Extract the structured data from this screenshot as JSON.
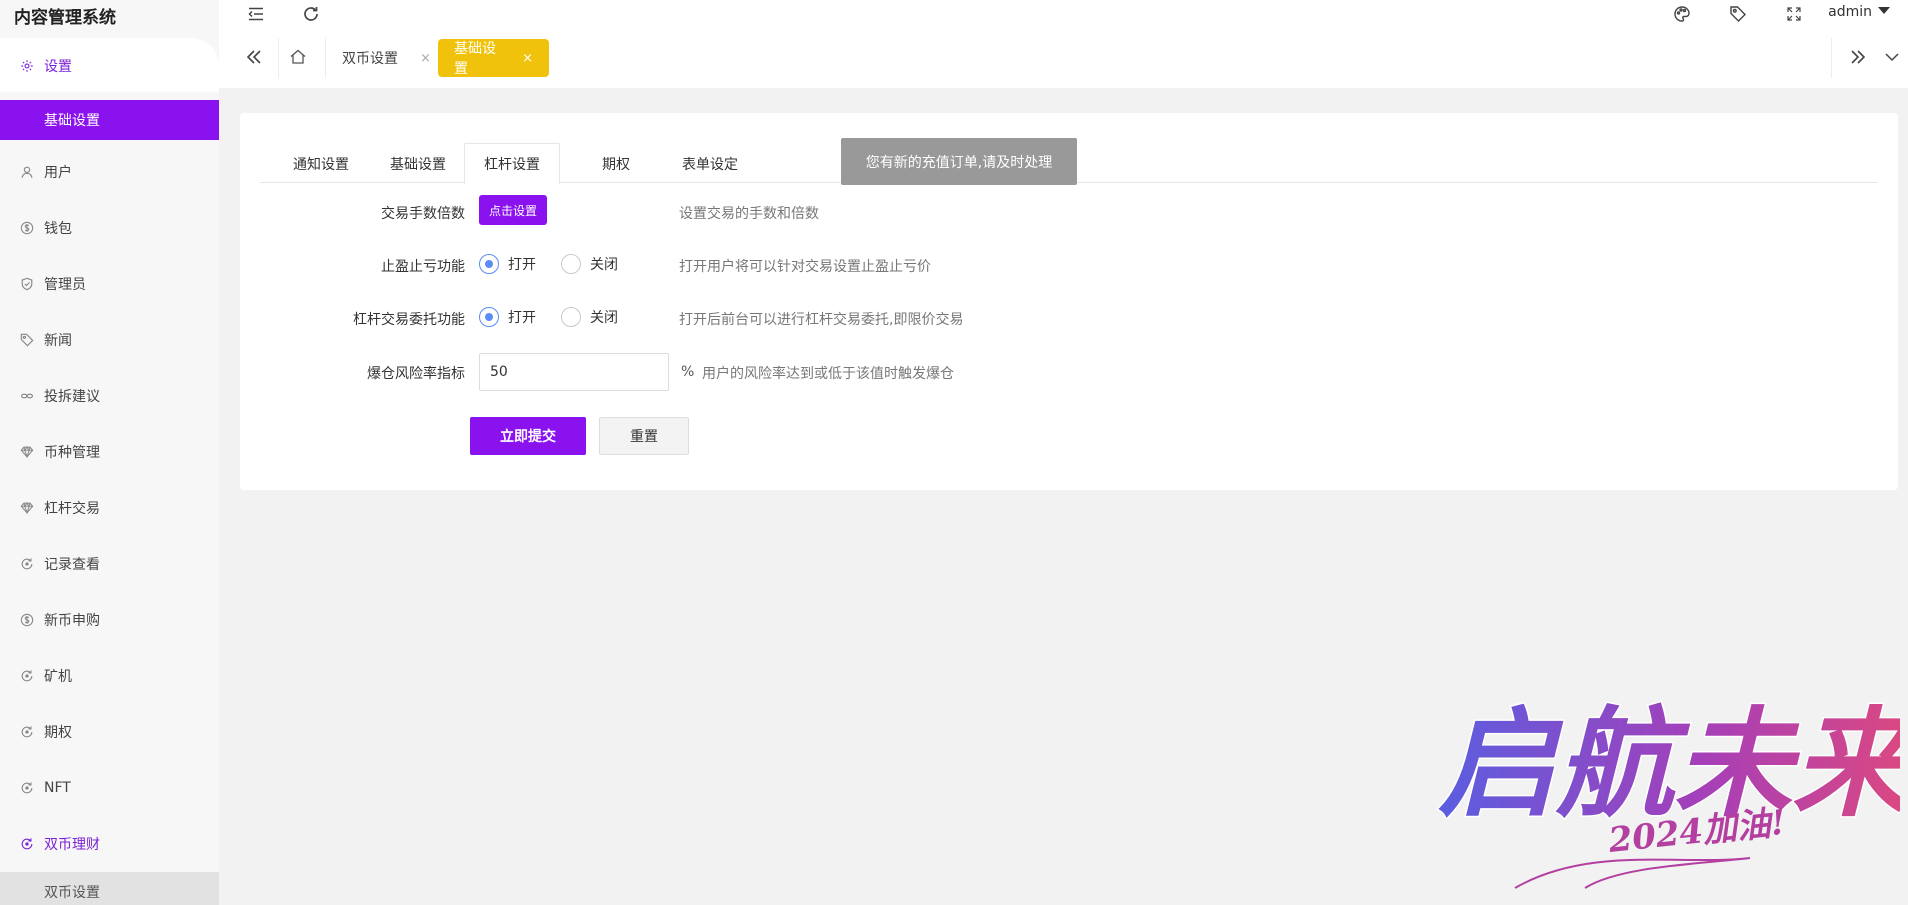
{
  "app": {
    "title": "内容管理系统",
    "user": "admin"
  },
  "sidebar": {
    "items": [
      {
        "label": "设置",
        "icon": "gear-icon"
      },
      {
        "label": "用户",
        "icon": "user-icon"
      },
      {
        "label": "钱包",
        "icon": "dollar-icon"
      },
      {
        "label": "管理员",
        "icon": "shield-icon"
      },
      {
        "label": "新闻",
        "icon": "tag-icon"
      },
      {
        "label": "投拆建议",
        "icon": "link-icon"
      },
      {
        "label": "币种管理",
        "icon": "diamond-icon"
      },
      {
        "label": "杠杆交易",
        "icon": "diamond-icon"
      },
      {
        "label": "记录查看",
        "icon": "cycle-icon"
      },
      {
        "label": "新币申购",
        "icon": "dollar-icon"
      },
      {
        "label": "矿机",
        "icon": "cycle-icon"
      },
      {
        "label": "期权",
        "icon": "cycle-icon"
      },
      {
        "label": "NFT",
        "icon": "cycle-icon"
      },
      {
        "label": "双币理财",
        "icon": "cycle-icon"
      }
    ],
    "active_sub": "基础设置",
    "bottom_sub": "双币设置"
  },
  "tabstrip": {
    "tabs": [
      {
        "label": "双币设置",
        "close": "×"
      },
      {
        "label": "基础设置",
        "close": "×"
      }
    ]
  },
  "settings": {
    "tabs": [
      "通知设置",
      "基础设置",
      "杠杆设置",
      "期权",
      "表单设定"
    ],
    "active_tab": "杠杆设置",
    "toast": "您有新的充值订单,请及时处理",
    "fee_label": "交易手数倍数",
    "fee_button": "点击设置",
    "fee_tip": "设置交易的手数和倍数",
    "stop_label": "止盈止亏功能",
    "stop_on": "打开",
    "stop_off": "关闭",
    "stop_tip": "打开用户将可以针对交易设置止盈止亏价",
    "entrust_label": "杠杆交易委托功能",
    "entrust_on": "打开",
    "entrust_off": "关闭",
    "entrust_tip": "打开后前台可以进行杠杆交易委托,即限价交易",
    "risk_label": "爆仓风险率指标",
    "risk_value": "50",
    "risk_unit": "%",
    "risk_tip": "用户的风险率达到或低于该值时触发爆仓",
    "submit": "立即提交",
    "reset": "重置"
  },
  "watermark": {
    "text": "启航未来",
    "sub": "2024加油!"
  },
  "colors": {
    "accent": "#8a12ee",
    "tab_active": "#f0c20c",
    "radio": "#5b8cf7"
  }
}
